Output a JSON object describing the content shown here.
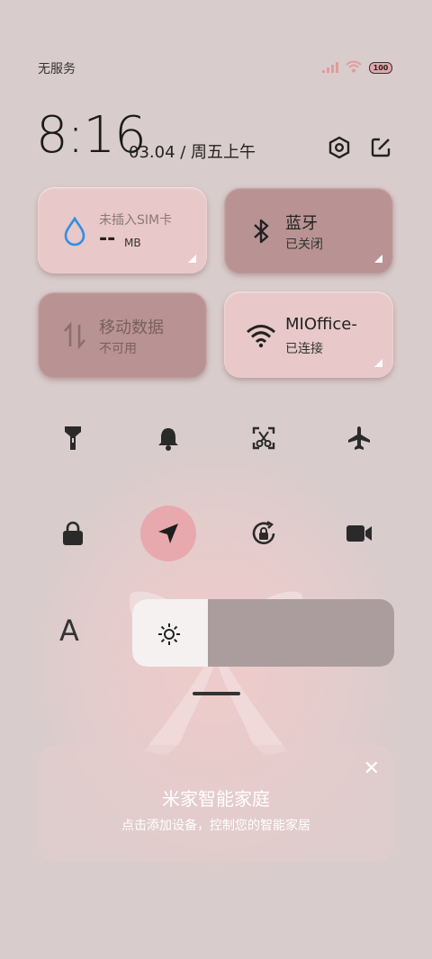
{
  "status": {
    "carrier": "无服务",
    "battery": "100"
  },
  "header": {
    "time": "8:16",
    "date": "03.04 / 周五上午"
  },
  "tiles": {
    "data": {
      "label": "未插入SIM卡",
      "value": "--",
      "unit": "MB"
    },
    "bluetooth": {
      "title": "蓝牙",
      "status": "已关闭"
    },
    "mobile_data": {
      "title": "移动数据",
      "status": "不可用"
    },
    "wifi": {
      "title": "MIOffice-",
      "status": "已连接"
    }
  },
  "toggles_row1": [
    "flashlight-icon",
    "bell-icon",
    "screenshot-icon",
    "airplane-icon"
  ],
  "toggles_row2": [
    "lock-icon",
    "location-icon",
    "rotation-lock-icon",
    "video-icon"
  ],
  "font_label": "A",
  "brightness": {
    "level": 0.29
  },
  "smart_home": {
    "title": "米家智能家庭",
    "subtitle": "点击添加设备，控制您的智能家居"
  },
  "colors": {
    "active_toggle": "#e7a9ad",
    "tile_light": "#e8c8c8",
    "tile_dark": "#b99393"
  }
}
